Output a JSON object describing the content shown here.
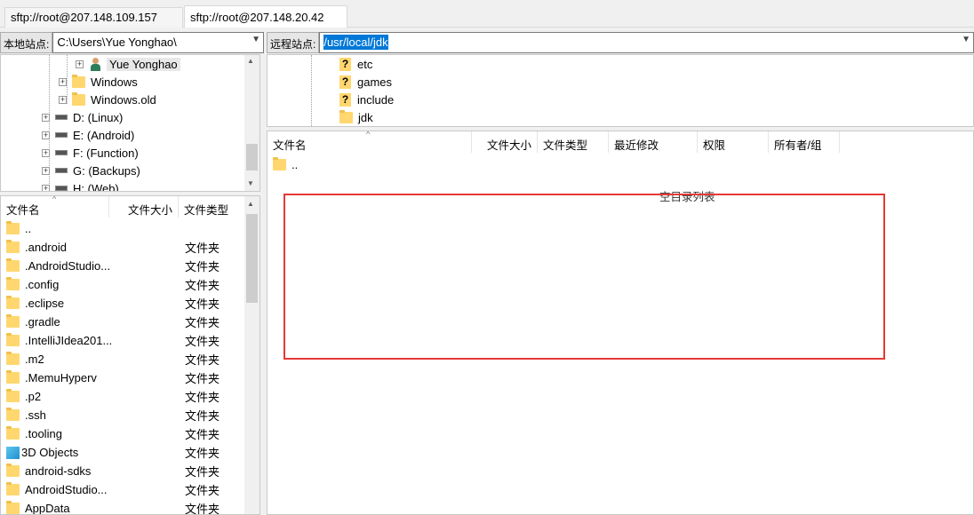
{
  "tabs": [
    {
      "label": "sftp://root@207.148.109.157"
    },
    {
      "label": "sftp://root@207.148.20.42"
    }
  ],
  "local": {
    "label": "本地站点:",
    "path": "C:\\Users\\Yue Yonghao\\",
    "tree": [
      "Yue Yonghao",
      "Windows",
      "Windows.old",
      "D: (Linux)",
      "E: (Android)",
      "F: (Function)",
      "G: (Backups)",
      "H: (Web)"
    ],
    "columns": {
      "name": "文件名",
      "size": "文件大小",
      "type": "文件类型"
    },
    "files": [
      {
        "name": "..",
        "type": ""
      },
      {
        "name": ".android",
        "type": "文件夹"
      },
      {
        "name": ".AndroidStudio...",
        "type": "文件夹"
      },
      {
        "name": ".config",
        "type": "文件夹"
      },
      {
        "name": ".eclipse",
        "type": "文件夹"
      },
      {
        "name": ".gradle",
        "type": "文件夹"
      },
      {
        "name": ".IntelliJIdea201...",
        "type": "文件夹"
      },
      {
        "name": ".m2",
        "type": "文件夹"
      },
      {
        "name": ".MemuHyperv",
        "type": "文件夹"
      },
      {
        "name": ".p2",
        "type": "文件夹"
      },
      {
        "name": ".ssh",
        "type": "文件夹"
      },
      {
        "name": ".tooling",
        "type": "文件夹"
      },
      {
        "name": "3D Objects",
        "type": "文件夹"
      },
      {
        "name": "android-sdks",
        "type": "文件夹"
      },
      {
        "name": "AndroidStudio...",
        "type": "文件夹"
      },
      {
        "name": "AppData",
        "type": "文件夹"
      }
    ]
  },
  "remote": {
    "label": "远程站点:",
    "path": "/usr/local/jdk",
    "tree": [
      "etc",
      "games",
      "include",
      "jdk"
    ],
    "columns": {
      "name": "文件名",
      "size": "文件大小",
      "type": "文件类型",
      "modified": "最近修改",
      "perms": "权限",
      "owner": "所有者/组"
    },
    "files": [
      {
        "name": ".."
      }
    ],
    "empty_message": "空目录列表"
  },
  "colors": {
    "highlight": "#e53935",
    "selection": "#0078d7"
  }
}
